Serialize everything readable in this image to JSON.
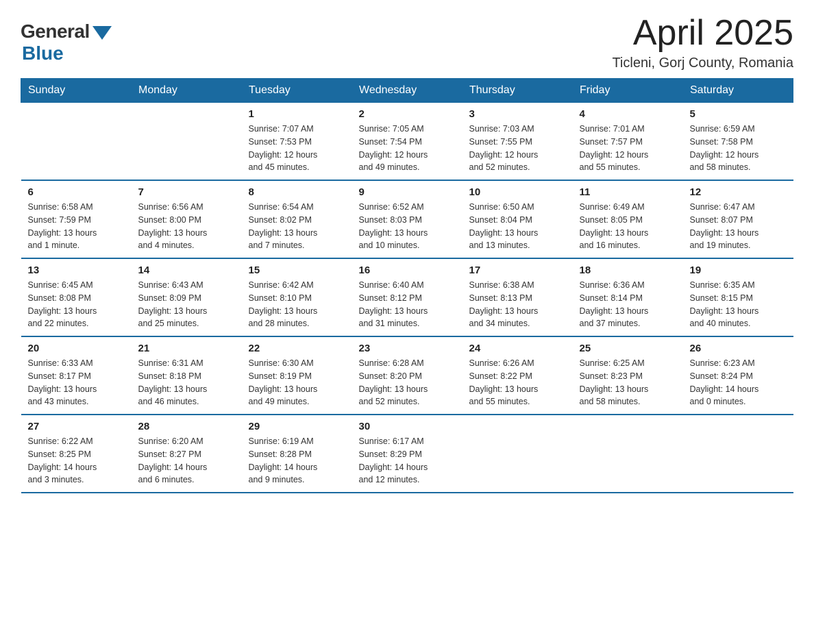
{
  "header": {
    "logo_general": "General",
    "logo_blue": "Blue",
    "month_year": "April 2025",
    "location": "Ticleni, Gorj County, Romania"
  },
  "calendar": {
    "days_of_week": [
      "Sunday",
      "Monday",
      "Tuesday",
      "Wednesday",
      "Thursday",
      "Friday",
      "Saturday"
    ],
    "weeks": [
      [
        {
          "day": "",
          "info": ""
        },
        {
          "day": "",
          "info": ""
        },
        {
          "day": "1",
          "info": "Sunrise: 7:07 AM\nSunset: 7:53 PM\nDaylight: 12 hours\nand 45 minutes."
        },
        {
          "day": "2",
          "info": "Sunrise: 7:05 AM\nSunset: 7:54 PM\nDaylight: 12 hours\nand 49 minutes."
        },
        {
          "day": "3",
          "info": "Sunrise: 7:03 AM\nSunset: 7:55 PM\nDaylight: 12 hours\nand 52 minutes."
        },
        {
          "day": "4",
          "info": "Sunrise: 7:01 AM\nSunset: 7:57 PM\nDaylight: 12 hours\nand 55 minutes."
        },
        {
          "day": "5",
          "info": "Sunrise: 6:59 AM\nSunset: 7:58 PM\nDaylight: 12 hours\nand 58 minutes."
        }
      ],
      [
        {
          "day": "6",
          "info": "Sunrise: 6:58 AM\nSunset: 7:59 PM\nDaylight: 13 hours\nand 1 minute."
        },
        {
          "day": "7",
          "info": "Sunrise: 6:56 AM\nSunset: 8:00 PM\nDaylight: 13 hours\nand 4 minutes."
        },
        {
          "day": "8",
          "info": "Sunrise: 6:54 AM\nSunset: 8:02 PM\nDaylight: 13 hours\nand 7 minutes."
        },
        {
          "day": "9",
          "info": "Sunrise: 6:52 AM\nSunset: 8:03 PM\nDaylight: 13 hours\nand 10 minutes."
        },
        {
          "day": "10",
          "info": "Sunrise: 6:50 AM\nSunset: 8:04 PM\nDaylight: 13 hours\nand 13 minutes."
        },
        {
          "day": "11",
          "info": "Sunrise: 6:49 AM\nSunset: 8:05 PM\nDaylight: 13 hours\nand 16 minutes."
        },
        {
          "day": "12",
          "info": "Sunrise: 6:47 AM\nSunset: 8:07 PM\nDaylight: 13 hours\nand 19 minutes."
        }
      ],
      [
        {
          "day": "13",
          "info": "Sunrise: 6:45 AM\nSunset: 8:08 PM\nDaylight: 13 hours\nand 22 minutes."
        },
        {
          "day": "14",
          "info": "Sunrise: 6:43 AM\nSunset: 8:09 PM\nDaylight: 13 hours\nand 25 minutes."
        },
        {
          "day": "15",
          "info": "Sunrise: 6:42 AM\nSunset: 8:10 PM\nDaylight: 13 hours\nand 28 minutes."
        },
        {
          "day": "16",
          "info": "Sunrise: 6:40 AM\nSunset: 8:12 PM\nDaylight: 13 hours\nand 31 minutes."
        },
        {
          "day": "17",
          "info": "Sunrise: 6:38 AM\nSunset: 8:13 PM\nDaylight: 13 hours\nand 34 minutes."
        },
        {
          "day": "18",
          "info": "Sunrise: 6:36 AM\nSunset: 8:14 PM\nDaylight: 13 hours\nand 37 minutes."
        },
        {
          "day": "19",
          "info": "Sunrise: 6:35 AM\nSunset: 8:15 PM\nDaylight: 13 hours\nand 40 minutes."
        }
      ],
      [
        {
          "day": "20",
          "info": "Sunrise: 6:33 AM\nSunset: 8:17 PM\nDaylight: 13 hours\nand 43 minutes."
        },
        {
          "day": "21",
          "info": "Sunrise: 6:31 AM\nSunset: 8:18 PM\nDaylight: 13 hours\nand 46 minutes."
        },
        {
          "day": "22",
          "info": "Sunrise: 6:30 AM\nSunset: 8:19 PM\nDaylight: 13 hours\nand 49 minutes."
        },
        {
          "day": "23",
          "info": "Sunrise: 6:28 AM\nSunset: 8:20 PM\nDaylight: 13 hours\nand 52 minutes."
        },
        {
          "day": "24",
          "info": "Sunrise: 6:26 AM\nSunset: 8:22 PM\nDaylight: 13 hours\nand 55 minutes."
        },
        {
          "day": "25",
          "info": "Sunrise: 6:25 AM\nSunset: 8:23 PM\nDaylight: 13 hours\nand 58 minutes."
        },
        {
          "day": "26",
          "info": "Sunrise: 6:23 AM\nSunset: 8:24 PM\nDaylight: 14 hours\nand 0 minutes."
        }
      ],
      [
        {
          "day": "27",
          "info": "Sunrise: 6:22 AM\nSunset: 8:25 PM\nDaylight: 14 hours\nand 3 minutes."
        },
        {
          "day": "28",
          "info": "Sunrise: 6:20 AM\nSunset: 8:27 PM\nDaylight: 14 hours\nand 6 minutes."
        },
        {
          "day": "29",
          "info": "Sunrise: 6:19 AM\nSunset: 8:28 PM\nDaylight: 14 hours\nand 9 minutes."
        },
        {
          "day": "30",
          "info": "Sunrise: 6:17 AM\nSunset: 8:29 PM\nDaylight: 14 hours\nand 12 minutes."
        },
        {
          "day": "",
          "info": ""
        },
        {
          "day": "",
          "info": ""
        },
        {
          "day": "",
          "info": ""
        }
      ]
    ]
  }
}
